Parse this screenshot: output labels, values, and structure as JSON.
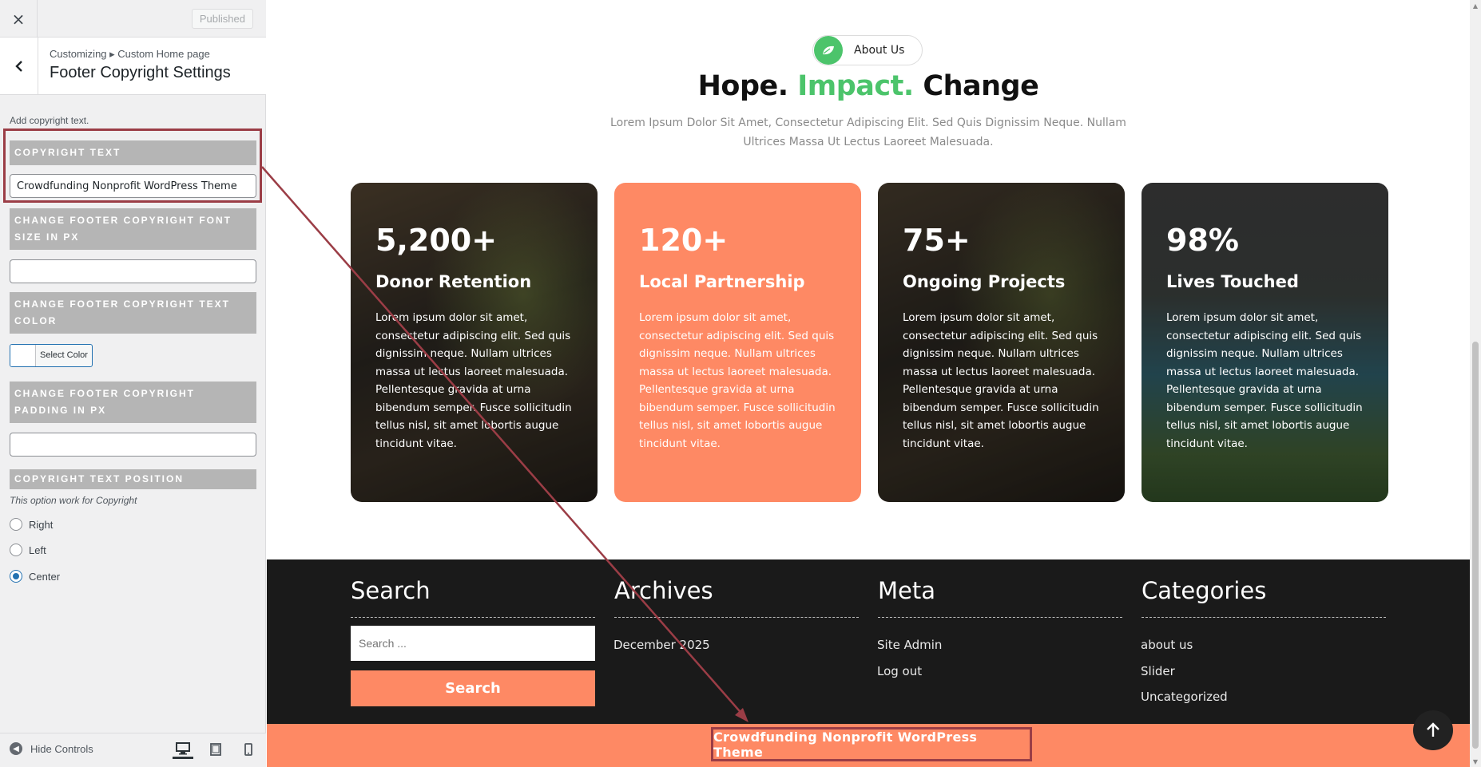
{
  "sidebar": {
    "close_icon": "×",
    "publish_label": "Published",
    "breadcrumb": "Customizing ▸ Custom Home page",
    "section_title": "Footer Copyright Settings",
    "description": "Add copyright text.",
    "controls": {
      "copyright_text_title": "Copyright Text",
      "copyright_text_value": "Crowdfunding Nonprofit WordPress Theme",
      "font_size_title": "Change Footer Copyright Font Size In PX",
      "font_size_value": "",
      "text_color_title": "Change Footer Copyright Text Color",
      "select_color_label": "Select Color",
      "padding_title": "Change Footer Copyright Padding In PX",
      "padding_value": "",
      "position_title": "Copyright Text Position",
      "position_note": "This option work for Copyright",
      "position_options": [
        "Right",
        "Left",
        "Center"
      ],
      "position_selected": "Center"
    },
    "footer": {
      "hide_controls_label": "Hide Controls",
      "devices": [
        "desktop",
        "tablet",
        "mobile"
      ],
      "active_device": "desktop"
    }
  },
  "preview": {
    "about_label": "About Us",
    "headline_parts": [
      "Hope.",
      "Impact.",
      "Change"
    ],
    "intro": "Lorem Ipsum Dolor Sit Amet, Consectetur Adipiscing Elit. Sed Quis Dignissim Neque. Nullam Ultrices Massa Ut Lectus Laoreet Malesuada.",
    "cards": [
      {
        "number": "5,200+",
        "label": "Donor Retention",
        "text": "Lorem ipsum dolor sit amet, consectetur adipiscing elit. Sed quis dignissim neque. Nullam ultrices massa ut lectus laoreet malesuada. Pellentesque gravida at urna bibendum semper. Fusce sollicitudin tellus nisl, sit amet lobortis augue tincidunt vitae."
      },
      {
        "number": "120+",
        "label": "Local Partnership",
        "text": "Lorem ipsum dolor sit amet, consectetur adipiscing elit. Sed quis dignissim neque. Nullam ultrices massa ut lectus laoreet malesuada. Pellentesque gravida at urna bibendum semper. Fusce sollicitudin tellus nisl, sit amet lobortis augue tincidunt vitae."
      },
      {
        "number": "75+",
        "label": "Ongoing Projects",
        "text": "Lorem ipsum dolor sit amet, consectetur adipiscing elit. Sed quis dignissim neque. Nullam ultrices massa ut lectus laoreet malesuada. Pellentesque gravida at urna bibendum semper. Fusce sollicitudin tellus nisl, sit amet lobortis augue tincidunt vitae."
      },
      {
        "number": "98%",
        "label": "Lives Touched",
        "text": "Lorem ipsum dolor sit amet, consectetur adipiscing elit. Sed quis dignissim neque. Nullam ultrices massa ut lectus laoreet malesuada. Pellentesque gravida at urna bibendum semper. Fusce sollicitudin tellus nisl, sit amet lobortis augue tincidunt vitae."
      }
    ],
    "footer_widgets": {
      "search": {
        "title": "Search",
        "placeholder": "Search ...",
        "button": "Search"
      },
      "archives": {
        "title": "Archives",
        "links": [
          "December 2025"
        ]
      },
      "meta": {
        "title": "Meta",
        "links": [
          "Site Admin",
          "Log out"
        ]
      },
      "categories": {
        "title": "Categories",
        "links": [
          "about us",
          "Slider",
          "Uncategorized"
        ]
      }
    },
    "copyright": "Crowdfunding Nonprofit WordPress Theme",
    "colors": {
      "accent_green": "#4cc46b",
      "accent_orange": "#fe8964",
      "annotation_red": "#9b3d46",
      "footer_dark": "#1a1a1a"
    }
  }
}
